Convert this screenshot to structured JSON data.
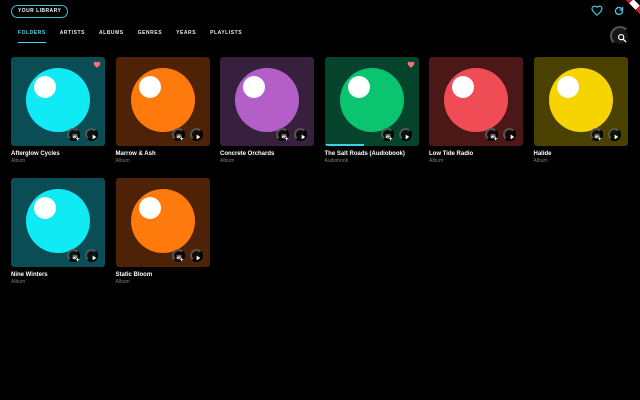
{
  "header": {
    "library_label": "YOUR LIBRARY"
  },
  "tabs": [
    "FOLDERS",
    "ARTISTS",
    "ALBUMS",
    "GENRES",
    "YEARS",
    "PLAYLISTS"
  ],
  "active_tab": "FOLDERS",
  "icons": {
    "favorite": "heart-icon",
    "refresh": "refresh-icon",
    "search": "search-icon",
    "add_to_playlist": "playlist-add-icon",
    "play": "play-icon"
  },
  "colors": {
    "accent": "#48d3e4",
    "favorite": "#ff6f78"
  },
  "cards": [
    {
      "title": "Afterglow Cycles",
      "type": "Album",
      "bg": "#0a4d54",
      "orb": "#10eaf4",
      "favorited": true
    },
    {
      "title": "Marrow & Ash",
      "type": "Album",
      "bg": "#4d2206",
      "orb": "#ff7a0c",
      "favorited": false
    },
    {
      "title": "Concrete Orchards",
      "type": "Album",
      "bg": "#37203e",
      "orb": "#b45fc8",
      "favorited": false
    },
    {
      "title": "The Salt Roads (Audiobook)",
      "type": "Audiobook",
      "bg": "#06432d",
      "orb": "#0bc46f",
      "favorited": true,
      "progress": 0.42
    },
    {
      "title": "Low Tide Radio",
      "type": "Album",
      "bg": "#4b1717",
      "orb": "#f04c55",
      "favorited": false
    },
    {
      "title": "Halide",
      "type": "Album",
      "bg": "#4a4000",
      "orb": "#f5d402",
      "favorited": false
    },
    {
      "title": "Nine Winters",
      "type": "Album",
      "bg": "#0a4d54",
      "orb": "#10eaf4",
      "favorited": false
    },
    {
      "title": "Static Bloom",
      "type": "Album",
      "bg": "#4d2206",
      "orb": "#ff7a0c",
      "favorited": false
    }
  ]
}
